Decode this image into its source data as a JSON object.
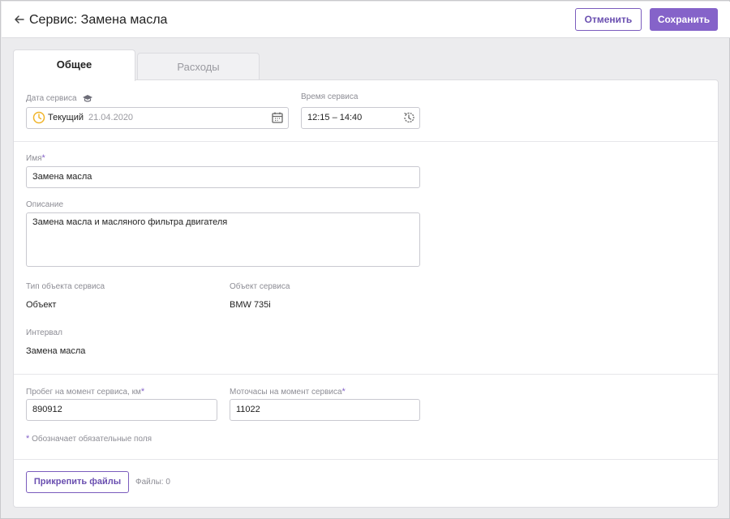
{
  "header": {
    "title": "Сервис: Замена масла",
    "cancel_label": "Отменить",
    "save_label": "Сохранить"
  },
  "tabs": [
    {
      "label": "Общее",
      "active": true
    },
    {
      "label": "Расходы",
      "active": false
    }
  ],
  "service_date": {
    "label": "Дата сервиса",
    "mode": "Текущий",
    "date": "21.04.2020"
  },
  "service_time": {
    "label": "Время сервиса",
    "value": "12:15 – 14:40"
  },
  "name": {
    "label": "Имя",
    "value": "Замена масла"
  },
  "description": {
    "label": "Описание",
    "value": "Замена масла и масляного фильтра двигателя"
  },
  "object_type": {
    "label": "Тип объекта сервиса",
    "value": "Объект"
  },
  "service_object": {
    "label": "Объект сервиса",
    "value": "BMW 735i"
  },
  "interval": {
    "label": "Интервал",
    "value": "Замена масла"
  },
  "mileage": {
    "label": "Пробег на момент сервиса, км",
    "value": "890912"
  },
  "engine_hours": {
    "label": "Моточасы на момент сервиса",
    "value": "11022"
  },
  "required_note": "Обозначает обязательные поля",
  "required_mark": "*",
  "attach_label": "Прикрепить файлы",
  "files_count": "Файлы: 0",
  "colors": {
    "accent": "#8563c9",
    "clock_icon": "#f0b429"
  },
  "icons": [
    "back-arrow-icon",
    "graduation-cap-icon",
    "clock-icon",
    "calendar-icon",
    "history-clock-icon"
  ]
}
